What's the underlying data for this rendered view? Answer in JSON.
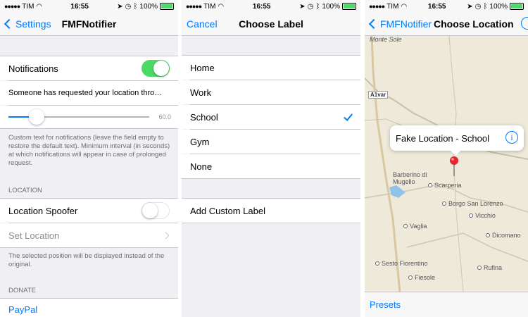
{
  "status": {
    "carrier": "TIM",
    "time": "16:55",
    "battery": "100%"
  },
  "screen1": {
    "back": "Settings",
    "title": "FMFNotifier",
    "notifications_label": "Notifications",
    "notifications_on": true,
    "message": "Someone has requested your location thro…",
    "slider_value": "60.0",
    "slider_fraction": 0.2,
    "footnote1": "Custom text for notifications (leave the field empty to restore the default text). Minimum interval (in seconds) at which notifications will appear in case of prolonged request.",
    "section_location": "LOCATION",
    "location_spoofer": "Location Spoofer",
    "spoofer_on": false,
    "set_location": "Set Location",
    "footnote2": "The selected position will be displayed instead of the original.",
    "section_donate": "DONATE",
    "paypal": "PayPal"
  },
  "screen2": {
    "cancel": "Cancel",
    "title": "Choose Label",
    "labels": [
      "Home",
      "Work",
      "School",
      "Gym",
      "None"
    ],
    "selected": "School",
    "add_custom": "Add Custom Label"
  },
  "screen3": {
    "back": "FMFNotifier",
    "title": "Choose Location",
    "callout": "Fake Location - School",
    "presets": "Presets",
    "places": [
      "Monte Sole",
      "A1var",
      "Barberino di Mugello",
      "Scarperia",
      "Borgo San Lorenzo",
      "Vicchio",
      "Vaglia",
      "Dicomano",
      "Sesto Fiorentino",
      "Fiesole",
      "Rufina"
    ]
  },
  "colors": {
    "accent": "#007aff",
    "toggle_on": "#4cd964",
    "group_bg": "#efeff4"
  }
}
